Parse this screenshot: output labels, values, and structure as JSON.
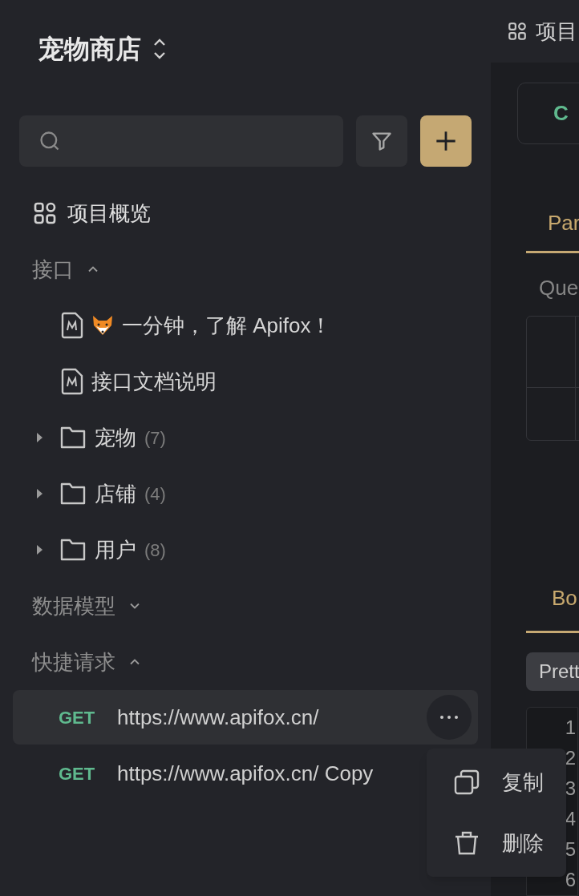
{
  "project": {
    "name": "宠物商店"
  },
  "overview": {
    "label": "项目概览"
  },
  "sections": [
    {
      "title": "接口",
      "expanded": true,
      "items": [
        {
          "kind": "doc",
          "label": "一分钟，了解 Apifox！",
          "emoji": true
        },
        {
          "kind": "doc",
          "label": "接口文档说明",
          "emoji": false
        },
        {
          "kind": "folder",
          "label": "宠物",
          "count": "(7)",
          "expanded": false
        },
        {
          "kind": "folder",
          "label": "店铺",
          "count": "(4)",
          "expanded": false
        },
        {
          "kind": "folder",
          "label": "用户",
          "count": "(8)",
          "expanded": false
        }
      ]
    },
    {
      "title": "数据模型",
      "expanded": false
    },
    {
      "title": "快捷请求",
      "expanded": true,
      "requests": [
        {
          "method": "GET",
          "url": "https://www.apifox.cn/",
          "selected": true
        },
        {
          "method": "GET",
          "url": "https://www.apifox.cn/ Copy",
          "selected": false
        }
      ]
    }
  ],
  "context_menu": [
    {
      "kind": "copy",
      "label": "复制"
    },
    {
      "kind": "delete",
      "label": "删除"
    }
  ],
  "main": {
    "top_tab": "项目",
    "method_partial": "C",
    "tabs": [
      {
        "label": "Par",
        "selected": true
      },
      {
        "label": "Bo",
        "selected": true
      }
    ],
    "query_label": "Que",
    "format_button": "Prett",
    "line_numbers": [
      "1",
      "2",
      "3",
      "4",
      "5",
      "6"
    ]
  }
}
